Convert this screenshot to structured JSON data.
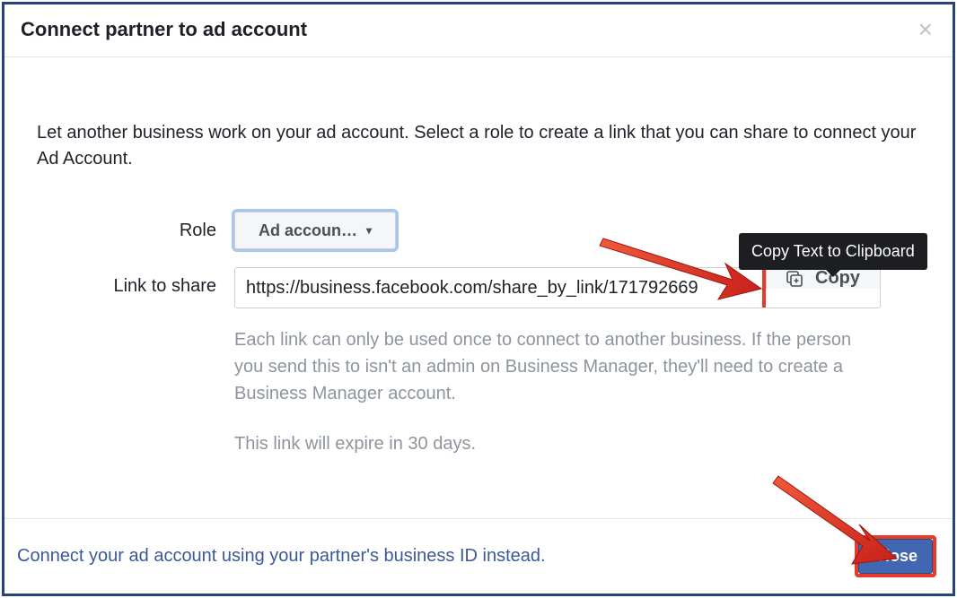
{
  "dialog": {
    "title": "Connect partner to ad account",
    "intro": "Let another business work on your ad account. Select a role to create a link that you can share to connect your Ad Account.",
    "role": {
      "label": "Role",
      "selected": "Ad accoun…"
    },
    "link": {
      "label": "Link to share",
      "value": "https://business.facebook.com/share_by_link/171792669"
    },
    "copy": {
      "label": "Copy",
      "tooltip": "Copy Text to Clipboard"
    },
    "help": "Each link can only be used once to connect to another business. If the person you send this to isn't an admin on Business Manager, they'll need to create a Business Manager account.",
    "expire": "This link will expire in 30 days.",
    "alt_link": "Connect your ad account using your partner's business ID instead.",
    "close": "Close"
  }
}
